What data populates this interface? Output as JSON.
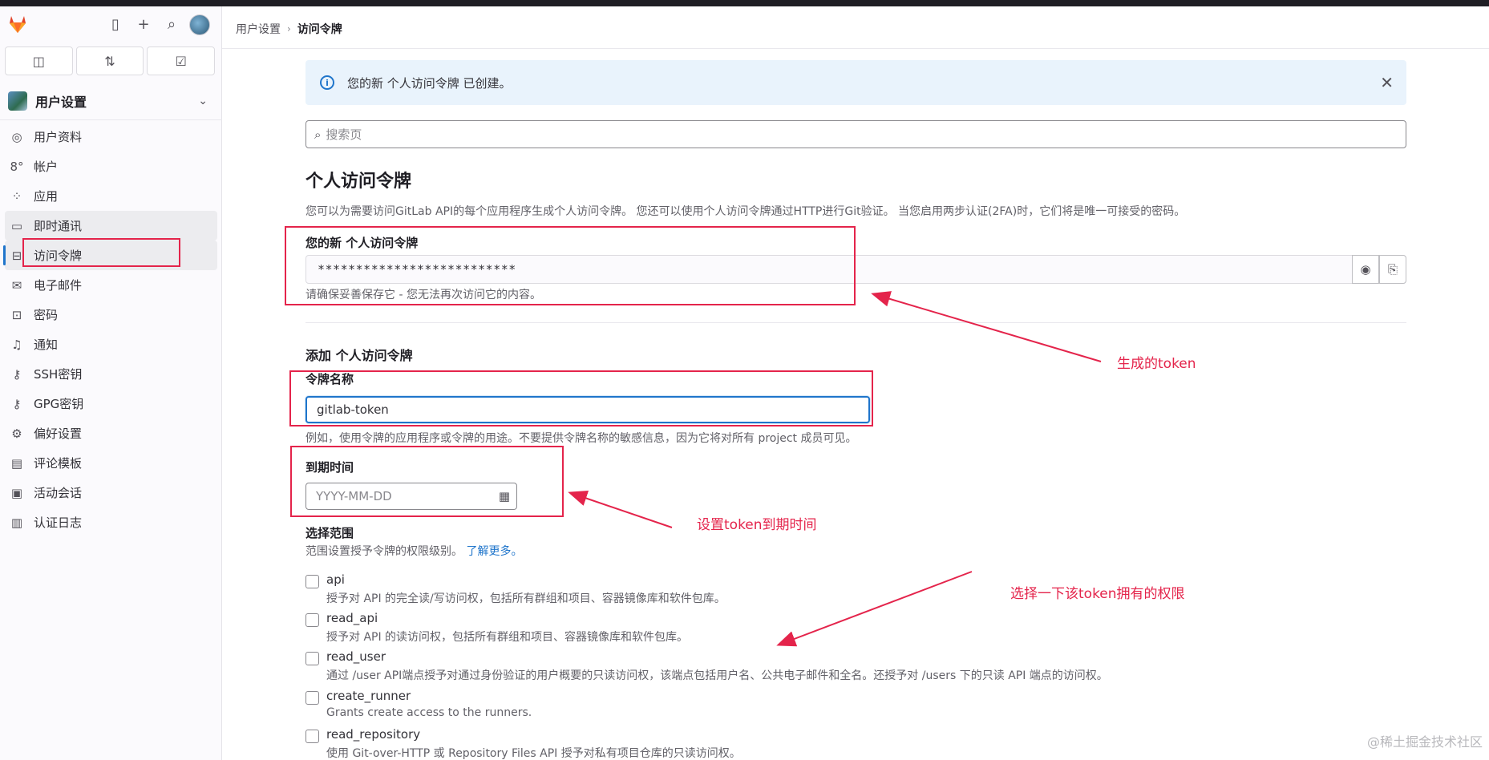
{
  "sidebar": {
    "context_title": "用户设置",
    "items": [
      {
        "label": "用户资料",
        "icon": "user-circle-icon"
      },
      {
        "label": "帐户",
        "icon": "account-icon"
      },
      {
        "label": "应用",
        "icon": "applications-icon"
      },
      {
        "label": "即时通讯",
        "icon": "chat-icon"
      },
      {
        "label": "访问令牌",
        "icon": "token-icon"
      },
      {
        "label": "电子邮件",
        "icon": "mail-icon"
      },
      {
        "label": "密码",
        "icon": "lock-icon"
      },
      {
        "label": "通知",
        "icon": "bell-icon"
      },
      {
        "label": "SSH密钥",
        "icon": "key-icon"
      },
      {
        "label": "GPG密钥",
        "icon": "key-icon"
      },
      {
        "label": "偏好设置",
        "icon": "preferences-icon"
      },
      {
        "label": "评论模板",
        "icon": "comment-template-icon"
      },
      {
        "label": "活动会话",
        "icon": "monitor-icon"
      },
      {
        "label": "认证日志",
        "icon": "log-icon"
      }
    ]
  },
  "breadcrumb": {
    "parent": "用户设置",
    "current": "访问令牌"
  },
  "alert": {
    "text": "您的新 个人访问令牌 已创建。"
  },
  "search": {
    "placeholder": "搜索页"
  },
  "page": {
    "title": "个人访问令牌",
    "description": "您可以为需要访问GitLab API的每个应用程序生成个人访问令牌。 您还可以使用个人访问令牌通过HTTP进行Git验证。 当您启用两步认证(2FA)时，它们将是唯一可接受的密码。"
  },
  "new_token": {
    "label": "您的新 个人访问令牌",
    "value": "**************************",
    "help": "请确保妥善保存它 - 您无法再次访问它的内容。"
  },
  "form": {
    "section_title": "添加 个人访问令牌",
    "name_label": "令牌名称",
    "name_value": "gitlab-token",
    "name_help": "例如，使用令牌的应用程序或令牌的用途。不要提供令牌名称的敏感信息，因为它将对所有 project 成员可见。",
    "expiry_label": "到期时间",
    "expiry_placeholder": "YYYY-MM-DD",
    "scopes_label": "选择范围",
    "scopes_help": "范围设置授予令牌的权限级别。",
    "scopes_link": "了解更多。",
    "scopes": [
      {
        "name": "api",
        "desc": "授予对 API 的完全读/写访问权，包括所有群组和项目、容器镜像库和软件包库。",
        "checked": false
      },
      {
        "name": "read_api",
        "desc": "授予对 API 的读访问权，包括所有群组和项目、容器镜像库和软件包库。",
        "checked": false
      },
      {
        "name": "read_user",
        "desc": "通过 /user API端点授予对通过身份验证的用户概要的只读访问权，该端点包括用户名、公共电子邮件和全名。还授予对 /users 下的只读 API 端点的访问权。",
        "checked": false
      },
      {
        "name": "create_runner",
        "desc": "Grants create access to the runners.",
        "checked": false
      },
      {
        "name": "read_repository",
        "desc": "使用 Git-over-HTTP 或 Repository Files API 授予对私有项目仓库的只读访问权。",
        "checked": false
      }
    ]
  },
  "annotations": {
    "token": "生成的token",
    "expiry": "设置token到期时间",
    "scopes": "选择一下该token拥有的权限"
  },
  "watermark": "@稀土掘金技术社区",
  "colors": {
    "accent": "#1f75cb",
    "annotation": "#e4244b",
    "alert_bg": "#e9f3fc"
  }
}
